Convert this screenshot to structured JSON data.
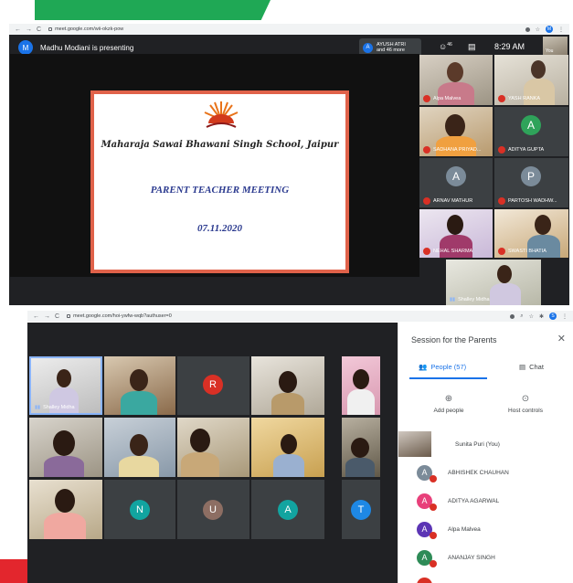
{
  "top_window": {
    "url": "meet.google.com/wii-okzk-pow",
    "presenter_avatar": "M",
    "presenting_text": "Madhu Modiani is presenting",
    "ayush_avatar": "A",
    "ayush_line1": "AYUSH ATRI",
    "ayush_line2": "and 46 more",
    "people_count": "46",
    "time": "8:29 AM",
    "self_label": "You",
    "profile_initial": "M",
    "slide": {
      "school": "Maharaja Sawai Bhawani Singh School, Jaipur",
      "title": "PARENT TEACHER MEETING",
      "date": "07.11.2020"
    },
    "tiles": [
      {
        "name": "Alpa Malvea"
      },
      {
        "name": "YASH RANKA"
      },
      {
        "name": "SADHANA PRIYAD..."
      },
      {
        "name": "ADITYA GUPTA",
        "initial": "A"
      },
      {
        "name": "ARNAV MATHUR",
        "initial": "A"
      },
      {
        "name": "PARTOSH WADHW...",
        "initial": "P"
      },
      {
        "name": "NEHAL SHARMA"
      },
      {
        "name": "SWASTI BHATIA"
      },
      {
        "name": "Shalley Midha"
      }
    ]
  },
  "bottom_window": {
    "url": "meet.google.com/hoi-ywfw-wqb?authuser=0",
    "profile_initial": "S",
    "tile_shalley": "Shalley Midha",
    "initials": [
      "R",
      "N",
      "U",
      "A",
      "T"
    ],
    "panel": {
      "title": "Session for the Parents",
      "tab_people": "People (57)",
      "tab_chat": "Chat",
      "add_people": "Add people",
      "host_controls": "Host controls",
      "people": [
        {
          "name": "Sunita Puri (You)"
        },
        {
          "name": "ABHISHEK CHAUHAN",
          "initial": "A",
          "color": "#7b8b99"
        },
        {
          "name": "ADITYA AGARWAL",
          "initial": "A",
          "color": "#e8407a"
        },
        {
          "name": "Alpa Malvea",
          "initial": "A",
          "color": "#5c35b5"
        },
        {
          "name": "ANANJAY SINGH",
          "initial": "A",
          "color": "#2e8b57"
        }
      ]
    }
  },
  "colors": {
    "meet_bg": "#202124",
    "mute_red": "#d93025",
    "accent_blue": "#1a73e8",
    "banner_green": "#1fa855"
  }
}
